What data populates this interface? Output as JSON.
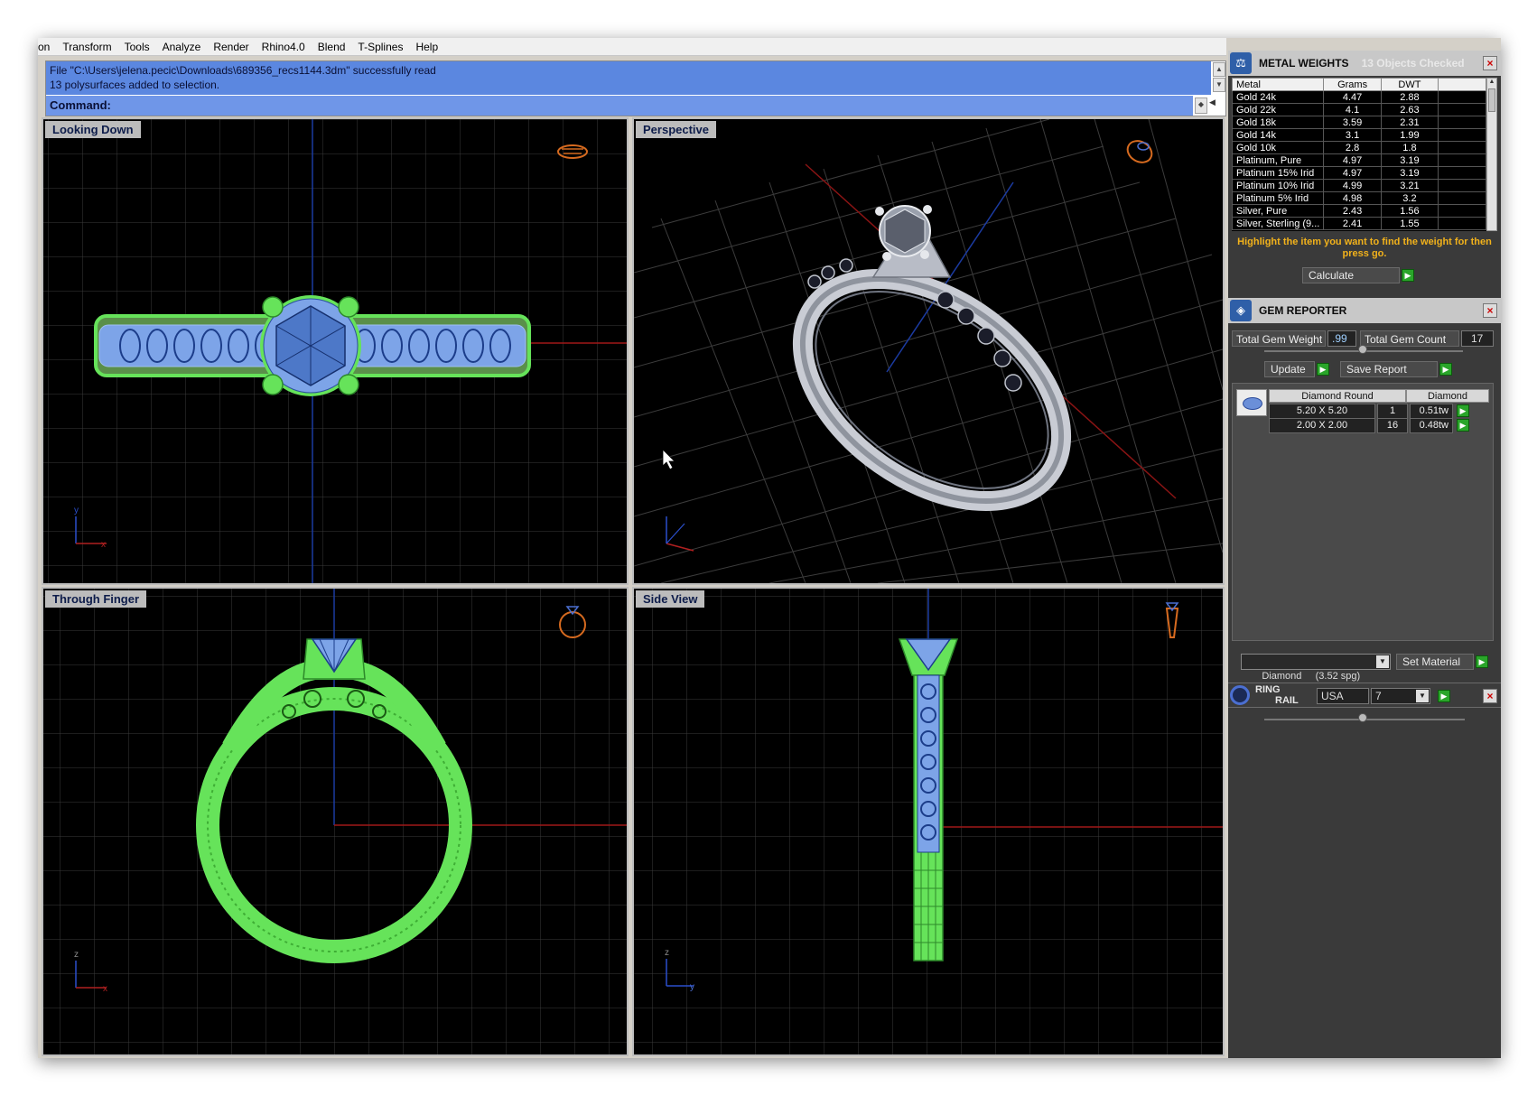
{
  "menubar": {
    "items": [
      "on",
      "Transform",
      "Tools",
      "Analyze",
      "Render",
      "Rhino4.0",
      "Blend",
      "T-Splines",
      "Help"
    ]
  },
  "command": {
    "history_line1": "File \"C:\\Users\\jelena.pecic\\Downloads\\689356_recs1144.3dm\" successfully read",
    "history_line2": "13 polysurfaces added to selection.",
    "prompt_label": "Command:"
  },
  "viewports": {
    "top": "Looking Down",
    "perspective": "Perspective",
    "front": "Through Finger",
    "right": "Side View"
  },
  "metal_weights": {
    "title": "METAL WEIGHTS",
    "objects_checked": "13 Objects Checked",
    "columns": [
      "Metal",
      "Grams",
      "DWT"
    ],
    "rows": [
      [
        "Gold 24k",
        "4.47",
        "2.88"
      ],
      [
        "Gold 22k",
        "4.1",
        "2.63"
      ],
      [
        "Gold 18k",
        "3.59",
        "2.31"
      ],
      [
        "Gold 14k",
        "3.1",
        "1.99"
      ],
      [
        "Gold 10k",
        "2.8",
        "1.8"
      ],
      [
        "Platinum, Pure",
        "4.97",
        "3.19"
      ],
      [
        "Platinum 15% Irid",
        "4.97",
        "3.19"
      ],
      [
        "Platinum 10% Irid",
        "4.99",
        "3.21"
      ],
      [
        "Platinum 5% Irid",
        "4.98",
        "3.2"
      ],
      [
        "Silver, Pure",
        "2.43",
        "1.56"
      ],
      [
        "Silver, Sterling (9...",
        "2.41",
        "1.55"
      ]
    ],
    "instruction": "Highlight the item you want to find the weight for then press go.",
    "calculate_label": "Calculate"
  },
  "gem_reporter": {
    "title": "GEM REPORTER",
    "total_weight_label": "Total Gem Weight",
    "total_weight_value": ".99",
    "total_count_label": "Total Gem Count",
    "total_count_value": "17",
    "update_label": "Update",
    "save_report_label": "Save Report",
    "table_header_shape": "Diamond Round",
    "table_header_material": "Diamond",
    "rows": [
      [
        "5.20 X 5.20",
        "1",
        "0.51tw"
      ],
      [
        "2.00 X 2.00",
        "16",
        "0.48tw"
      ]
    ],
    "material_select": "Diamond     (3.52 spg)",
    "set_material_label": "Set Material"
  },
  "ring_rail": {
    "title_line1": "RING",
    "title_line2": "RAIL",
    "country": "USA",
    "size": "7"
  },
  "colors": {
    "wire_green": "#66e35a",
    "wire_blue": "#7da4e8",
    "grid": "#3a3a3a",
    "axis_red": "#a01818",
    "axis_blue": "#1b3aa0",
    "panel_bg": "#3a3a3a",
    "instruction_text": "#f2b21b"
  }
}
